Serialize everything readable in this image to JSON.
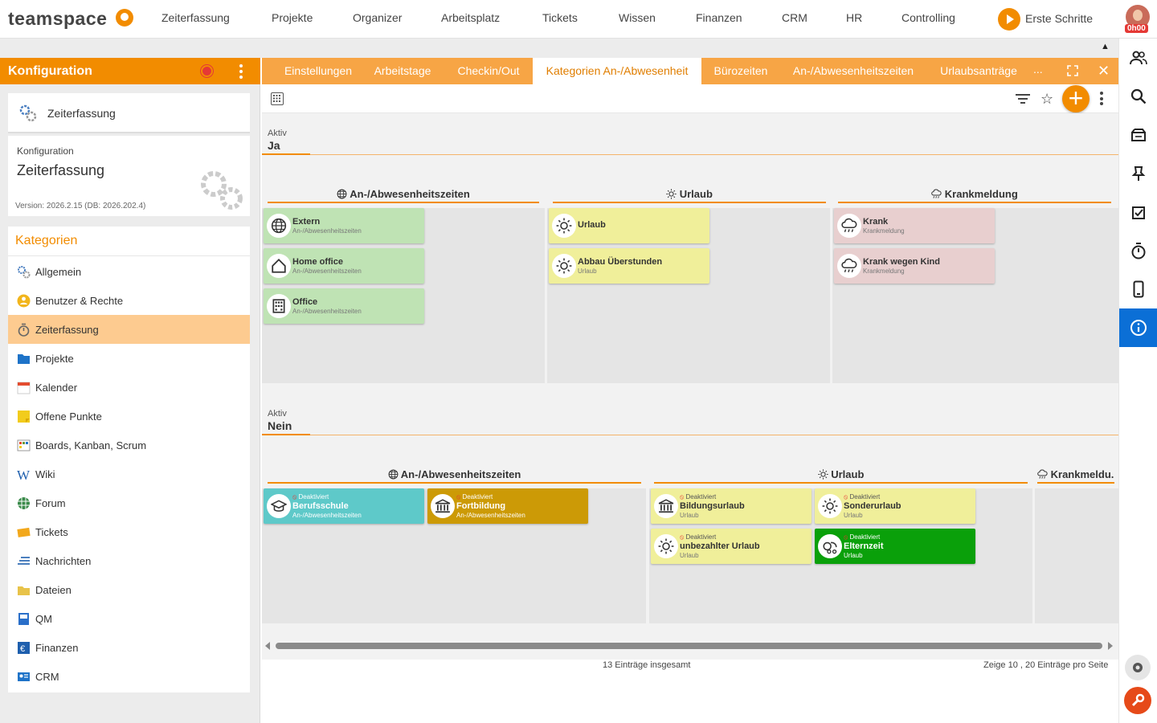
{
  "app": {
    "logo": "teamspace"
  },
  "topnav": [
    "Zeiterfassung",
    "Projekte",
    "Organizer",
    "Arbeitsplatz",
    "Tickets",
    "Wissen",
    "Finanzen",
    "CRM",
    "HR",
    "Controlling"
  ],
  "start_label": "Erste Schritte",
  "time_badge": "0h00",
  "sidebar": {
    "title": "Konfiguration",
    "module_card": "Zeiterfassung",
    "config_small": "Konfiguration",
    "config_big": "Zeiterfassung",
    "version": "Version: 2026.2.15 (DB: 2026.202.4)",
    "categories_title": "Kategorien",
    "categories": [
      {
        "label": "Allgemein",
        "icon": "gears-icon",
        "color": "#4a7fc1"
      },
      {
        "label": "Benutzer & Rechte",
        "icon": "users-icon",
        "color": "#f2b51c"
      },
      {
        "label": "Zeiterfassung",
        "icon": "stopwatch-icon",
        "color": "#666666",
        "active": true
      },
      {
        "label": "Projekte",
        "icon": "folder-icon",
        "color": "#1e73c8"
      },
      {
        "label": "Kalender",
        "icon": "calendar-icon",
        "color": "#e34c2f"
      },
      {
        "label": "Offene Punkte",
        "icon": "sticky-note-icon",
        "color": "#f2cc1c"
      },
      {
        "label": "Boards, Kanban, Scrum",
        "icon": "board-icon",
        "color": "#6a9a3a"
      },
      {
        "label": "Wiki",
        "icon": "wiki-icon",
        "color": "#1e5fae"
      },
      {
        "label": "Forum",
        "icon": "forum-icon",
        "color": "#3a8a4a"
      },
      {
        "label": "Tickets",
        "icon": "tickets-icon",
        "color": "#f2a81c"
      },
      {
        "label": "Nachrichten",
        "icon": "messages-icon",
        "color": "#1e5fae"
      },
      {
        "label": "Dateien",
        "icon": "files-icon",
        "color": "#e8c34a"
      },
      {
        "label": "QM",
        "icon": "qm-icon",
        "color": "#2a6fc9"
      },
      {
        "label": "Finanzen",
        "icon": "finance-icon",
        "color": "#1e5fae"
      },
      {
        "label": "CRM",
        "icon": "crm-icon",
        "color": "#1e73c8"
      }
    ]
  },
  "tabs": [
    "Einstellungen",
    "Arbeitstage",
    "Checkin/Out",
    "Kategorien An-/Abwesenheit",
    "Bürozeiten",
    "An-/Abwesenheitszeiten",
    "Urlaubsanträge"
  ],
  "tabs_more": "...",
  "groups": [
    {
      "label": "Aktiv",
      "value": "Ja",
      "columns": [
        {
          "title": "An-/Abwesenheitszeiten",
          "icon": "globe-icon",
          "cards": [
            {
              "title": "Extern",
              "sub": "An-/Abwesenheitszeiten",
              "icon": "globe-icon",
              "color": "#bfe3b4"
            },
            {
              "title": "Home office",
              "sub": "An-/Abwesenheitszeiten",
              "icon": "home-icon",
              "color": "#bfe3b4"
            },
            {
              "title": "Office",
              "sub": "An-/Abwesenheitszeiten",
              "icon": "building-icon",
              "color": "#bfe3b4"
            }
          ]
        },
        {
          "title": "Urlaub",
          "icon": "sun-icon",
          "cards": [
            {
              "title": "Urlaub",
              "sub": "",
              "icon": "sun-icon",
              "color": "#f0ef9a"
            },
            {
              "title": "Abbau Überstunden",
              "sub": "Urlaub",
              "icon": "sun-icon",
              "color": "#f0ef9a"
            }
          ]
        },
        {
          "title": "Krankmeldung",
          "icon": "rain-icon",
          "cards": [
            {
              "title": "Krank",
              "sub": "Krankmeldung",
              "icon": "rain-icon",
              "color": "#e8cfcf"
            },
            {
              "title": "Krank wegen Kind",
              "sub": "Krankmeldung",
              "icon": "rain-icon",
              "color": "#e8cfcf"
            }
          ]
        }
      ]
    },
    {
      "label": "Aktiv",
      "value": "Nein",
      "columns": [
        {
          "title": "An-/Abwesenheitszeiten",
          "icon": "globe-icon",
          "cards": [
            {
              "title": "Berufsschule",
              "sub": "An-/Abwesenheitszeiten",
              "deact": "Deaktiviert",
              "icon": "graduation-icon",
              "color": "#5ec9c9",
              "dark": true
            },
            {
              "title": "Fortbildung",
              "sub": "An-/Abwesenheitszeiten",
              "deact": "Deaktiviert",
              "icon": "institution-icon",
              "color": "#cc9a06",
              "dark": true
            }
          ]
        },
        {
          "title": "Urlaub",
          "icon": "sun-icon",
          "cards": [
            {
              "title": "Bildungsurlaub",
              "sub": "Urlaub",
              "deact": "Deaktiviert",
              "icon": "institution-icon",
              "color": "#f0ef9a"
            },
            {
              "title": "Sonderurlaub",
              "sub": "Urlaub",
              "deact": "Deaktiviert",
              "icon": "sun-icon",
              "color": "#f0ef9a"
            },
            {
              "title": "unbezahlter Urlaub",
              "sub": "Urlaub",
              "deact": "Deaktiviert",
              "icon": "sun-icon",
              "color": "#f0ef9a"
            },
            {
              "title": "Elternzeit",
              "sub": "Urlaub",
              "deact": "Deaktiviert",
              "icon": "baby-icon",
              "color": "#0aa00a",
              "dark": true
            }
          ]
        },
        {
          "title": "Krankmeldu...",
          "icon": "rain-icon",
          "cards": []
        }
      ]
    }
  ],
  "footer": {
    "total": "13 Einträge insgesamt",
    "pager": "Zeige  10 ,  20  Einträge pro Seite"
  }
}
